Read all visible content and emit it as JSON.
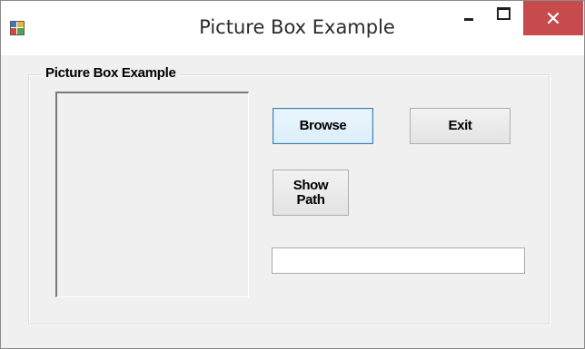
{
  "window": {
    "title": "Picture Box Example",
    "icon": "app-window-icon"
  },
  "titlebar_buttons": {
    "minimize": "minimize-icon",
    "maximize": "maximize-icon",
    "close": "close-icon",
    "close_color": "#c74a4c"
  },
  "groupbox": {
    "label": "Picture Box Example"
  },
  "buttons": {
    "browse": "Browse",
    "exit": "Exit",
    "show_path": "Show\nPath"
  },
  "path_field": {
    "value": ""
  }
}
